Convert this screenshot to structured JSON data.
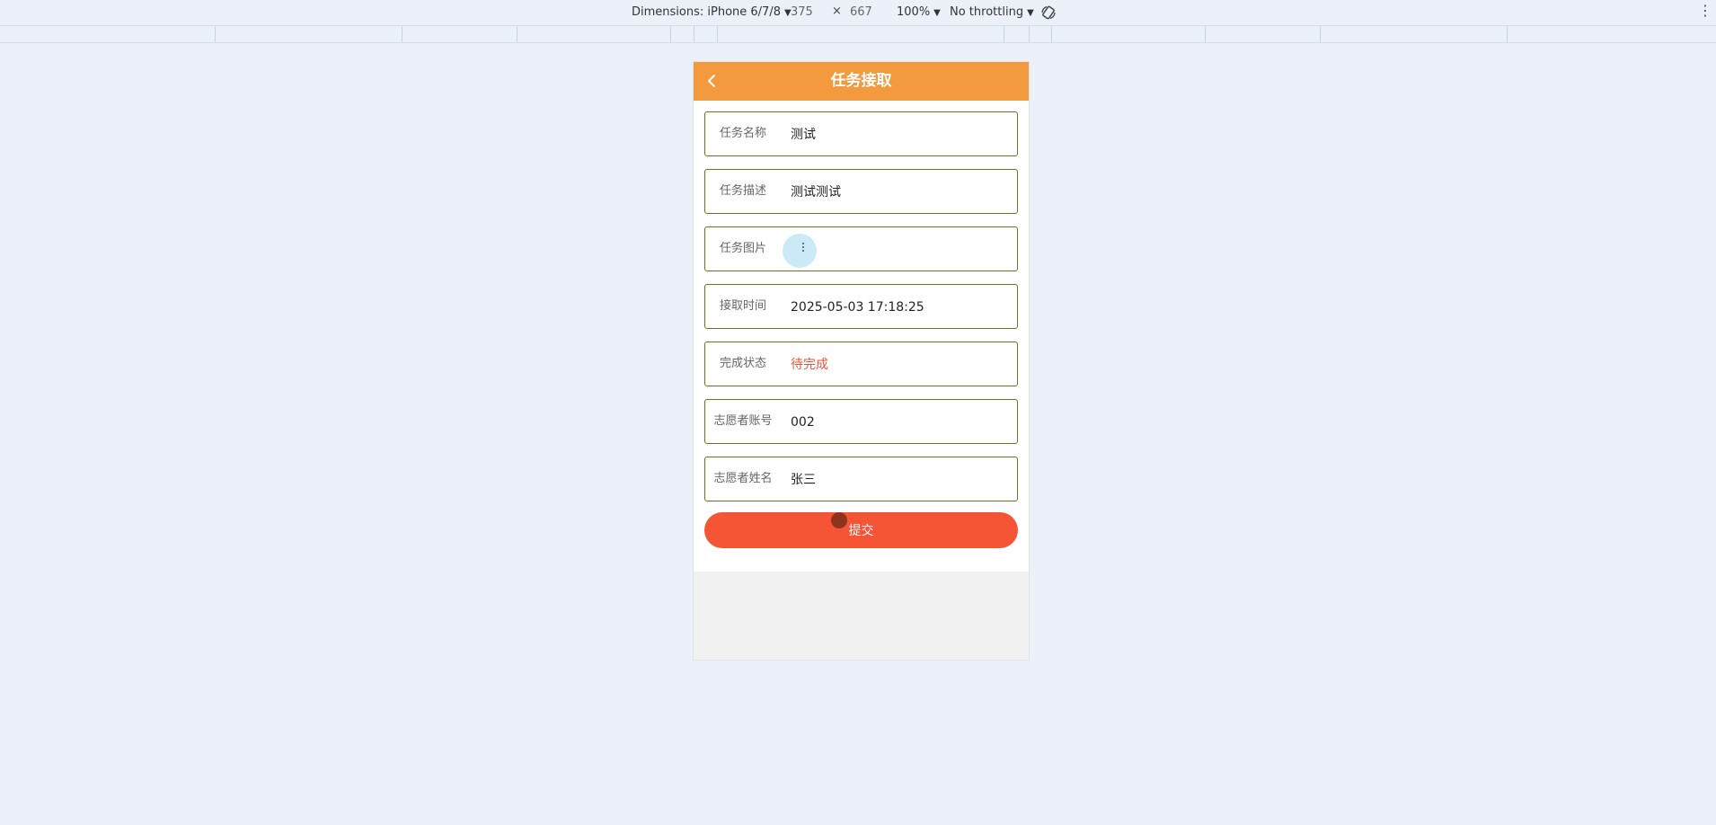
{
  "devtools": {
    "dimensions_label": "Dimensions: iPhone 6/7/8",
    "width": "375",
    "times": "×",
    "height": "667",
    "zoom": "100%",
    "throttling": "No throttling"
  },
  "page": {
    "title": "任务接取"
  },
  "form": {
    "rows": [
      {
        "label": "任务名称",
        "value": "测试"
      },
      {
        "label": "任务描述",
        "value": "测试测试"
      },
      {
        "label": "任务图片",
        "value": ""
      },
      {
        "label": "接取时间",
        "value": "2025-05-03 17:18:25"
      },
      {
        "label": "完成状态",
        "value": "待完成"
      },
      {
        "label": "志愿者账号",
        "value": "002"
      },
      {
        "label": "志愿者姓名",
        "value": "张三"
      }
    ],
    "submit_label": "提交"
  },
  "colors": {
    "nav": "#f39a3f",
    "submit": "#f55435",
    "status_pending": "#e5573b"
  }
}
